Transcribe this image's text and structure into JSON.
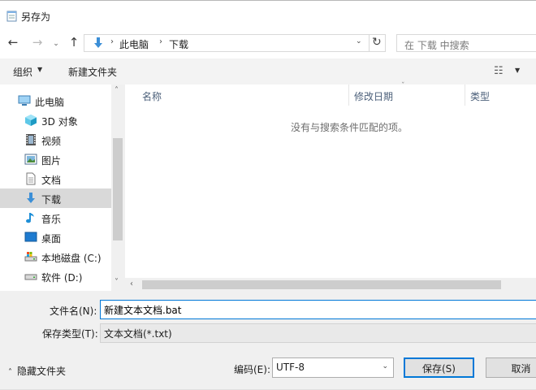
{
  "window": {
    "title": "另存为"
  },
  "nav": {
    "back": "←",
    "forward": "→",
    "recent": "⌄",
    "up": "↑",
    "breadcrumb_sep": "›",
    "breadcrumb": [
      "此电脑",
      "下载"
    ],
    "dropdown": "⌄",
    "refresh": "↻",
    "search_placeholder": "在 下载 中搜索"
  },
  "toolbar": {
    "organize": "组织",
    "organize_arrow": "▼",
    "new_folder": "新建文件夹",
    "view_icon": "☷",
    "view_arrow": "▼"
  },
  "sidebar": {
    "items": [
      {
        "label": "此电脑",
        "icon": "pc-icon"
      },
      {
        "label": "3D 对象",
        "icon": "cube-icon"
      },
      {
        "label": "视频",
        "icon": "video-icon"
      },
      {
        "label": "图片",
        "icon": "picture-icon"
      },
      {
        "label": "文档",
        "icon": "document-icon"
      },
      {
        "label": "下载",
        "icon": "download-icon",
        "selected": true
      },
      {
        "label": "音乐",
        "icon": "music-icon"
      },
      {
        "label": "桌面",
        "icon": "desktop-icon"
      },
      {
        "label": "本地磁盘 (C:)",
        "icon": "drive-icon"
      },
      {
        "label": "软件 (D:)",
        "icon": "drive-icon"
      }
    ],
    "scroll_up": "˄",
    "scroll_down": "˅"
  },
  "filelist": {
    "columns": [
      "名称",
      "修改日期",
      "类型"
    ],
    "sort_indicator": "ˇ",
    "empty_message": "没有与搜索条件匹配的项。",
    "scroll_left": "‹"
  },
  "form": {
    "filename_label": "文件名(N):",
    "filename_value": "新建文本文档.bat",
    "filetype_label": "保存类型(T):",
    "filetype_value": "文本文档(*.txt)",
    "hide_folders": "隐藏文件夹",
    "hide_folders_icon": "˄",
    "encoding_label": "编码(E):",
    "encoding_value": "UTF-8",
    "encoding_arrow": "⌄",
    "save": "保存(S)",
    "cancel": "取消"
  },
  "colors": {
    "accent": "#0078d7",
    "selected": "#d9d9d9",
    "folder_blue": "#3c8fd7"
  }
}
